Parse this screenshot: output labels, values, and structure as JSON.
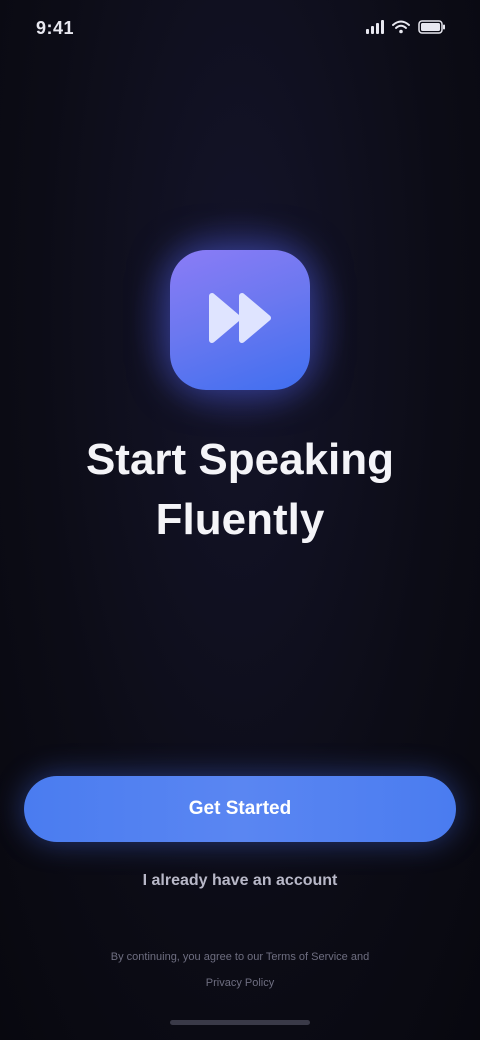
{
  "status_bar": {
    "time": "9:41",
    "signal_icon": "signal-icon",
    "wifi_icon": "wifi-icon",
    "battery_icon": "battery-icon"
  },
  "app_icon": {
    "icon": "fast-forward-icon",
    "gradient_start": "#8b7cf6",
    "gradient_end": "#3f6ff0"
  },
  "headline": {
    "line1": "Start Speaking",
    "line2": "Fluently"
  },
  "actions": {
    "primary_label": "Get Started",
    "secondary_label": "I already have an account"
  },
  "footer": {
    "legal_line1": "By continuing, you agree to our Terms of Service and",
    "legal_line2": "Privacy Policy"
  },
  "colors": {
    "background": "#0c0c16",
    "accent": "#4a7cf0"
  }
}
